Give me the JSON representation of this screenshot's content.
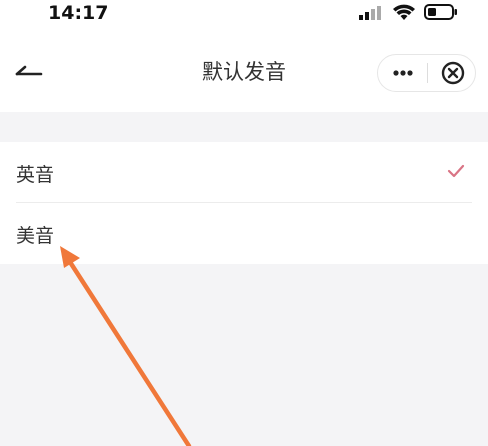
{
  "status_bar": {
    "time": "14:17",
    "icons": [
      "signal-icon",
      "wifi-icon",
      "battery-icon"
    ]
  },
  "nav": {
    "title": "默认发音",
    "back_icon": "back-arrow-icon",
    "more_icon": "more-dots-icon",
    "close_icon": "close-circle-icon"
  },
  "options": [
    {
      "label": "英音",
      "selected": true,
      "icon": "check-icon"
    },
    {
      "label": "美音",
      "selected": false
    }
  ],
  "colors": {
    "check": "#d97485",
    "annotation_arrow": "#f0783a",
    "background": "#f4f4f6"
  }
}
